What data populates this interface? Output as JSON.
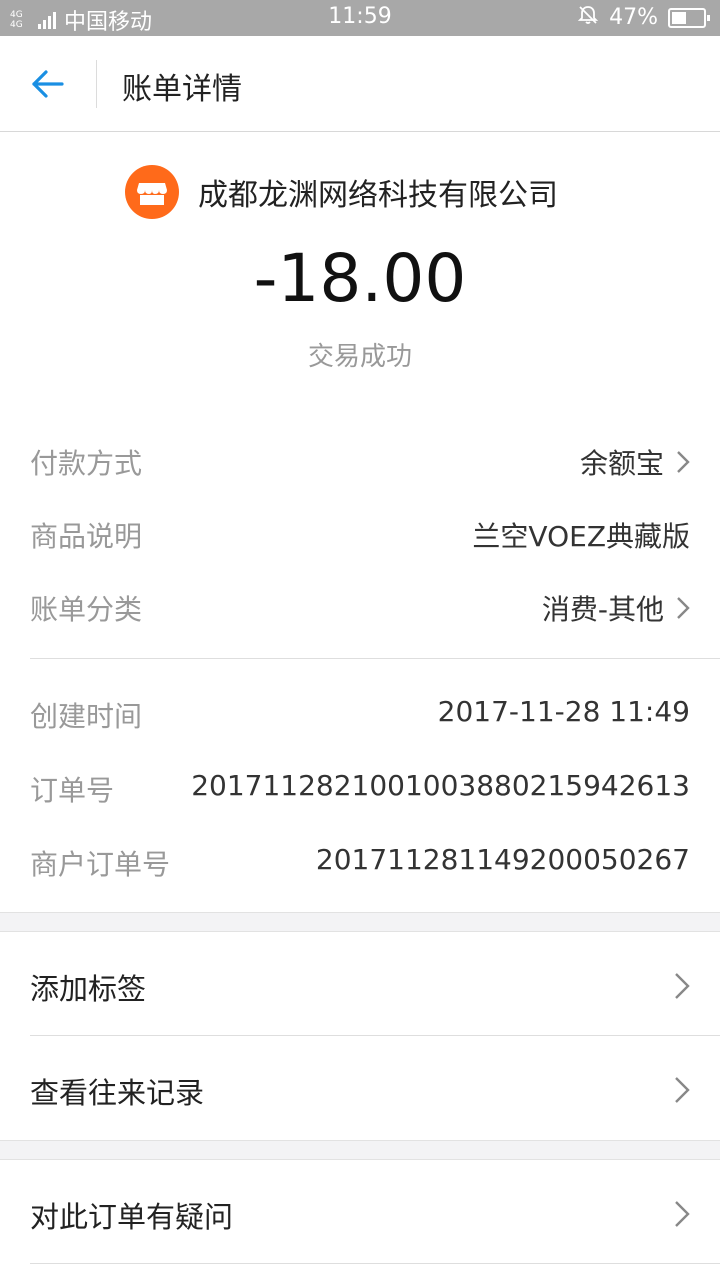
{
  "status_bar": {
    "network": "4G 4G",
    "carrier": "中国移动",
    "time": "11:59",
    "battery": "47%",
    "battery_level": 0.47
  },
  "header": {
    "title": "账单详情",
    "back_icon": "arrow-left-icon"
  },
  "merchant": {
    "name": "成都龙渊网络科技有限公司",
    "icon": "store-icon",
    "icon_color": "#ff6a1a"
  },
  "transaction": {
    "amount": "-18.00",
    "status": "交易成功"
  },
  "details": {
    "payment_method": {
      "label": "付款方式",
      "value": "余额宝"
    },
    "product": {
      "label": "商品说明",
      "value": "兰空VOEZ典藏版"
    },
    "category": {
      "label": "账单分类",
      "value": "消费-其他"
    },
    "created_time": {
      "label": "创建时间",
      "value": "2017-11-28 11:49"
    },
    "order_no": {
      "label": "订单号",
      "value": "2017112821001003880215942613"
    },
    "merchant_order_no": {
      "label": "商户订单号",
      "value": "20171128114920005​0267"
    }
  },
  "actions": {
    "add_tag": "添加标签",
    "view_history": "查看往来记录",
    "question_order": "对此订单有疑问"
  },
  "colors": {
    "accent": "#1a8fe3",
    "status_bar": "#a8a8a8",
    "secondary_text": "#999999"
  }
}
